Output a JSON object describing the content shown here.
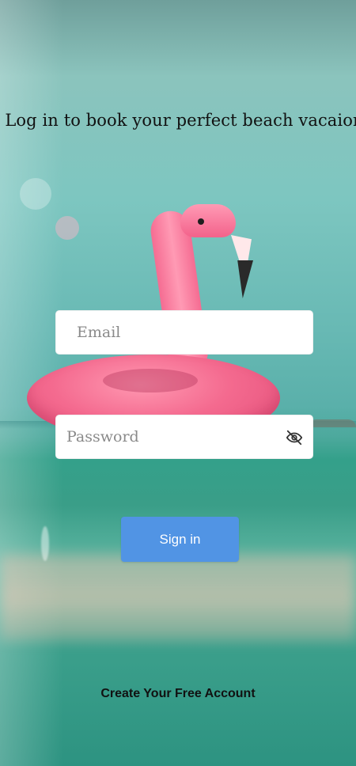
{
  "header": {
    "title": "Log in to book your perfect beach vacaion"
  },
  "form": {
    "email_placeholder": "Email",
    "password_placeholder": "Password",
    "signin_label": "Sign in",
    "password_toggle_icon": "eye-off-icon"
  },
  "footer": {
    "create_account_label": "Create Your Free Account"
  },
  "colors": {
    "primary_button": "#5194e4",
    "text": "#111111"
  }
}
